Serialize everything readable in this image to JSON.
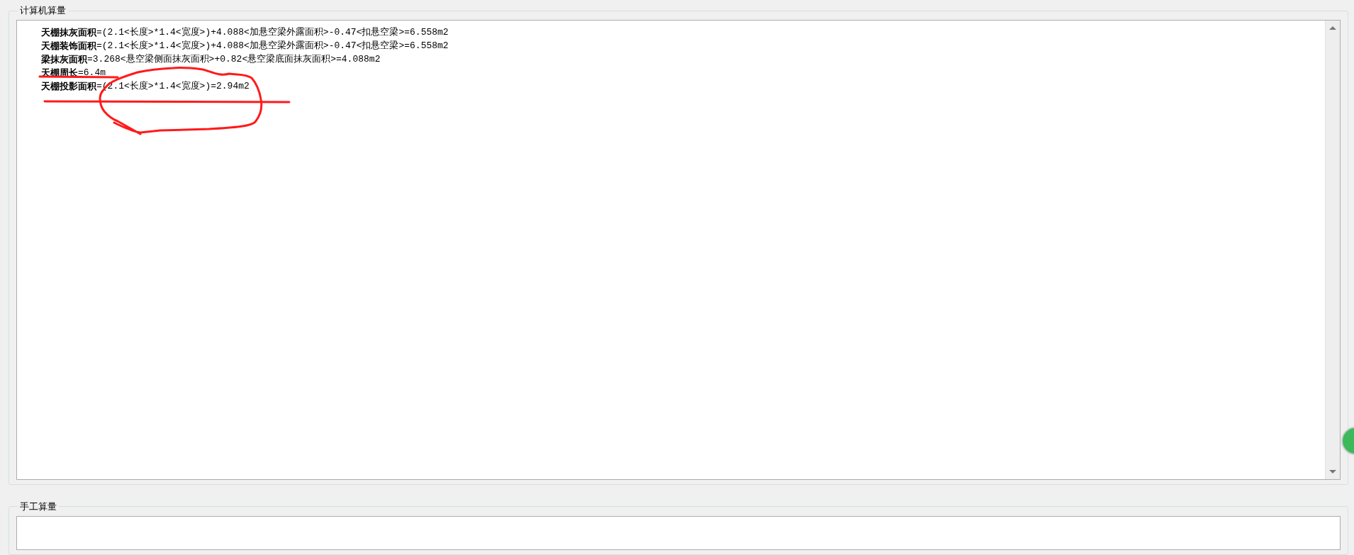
{
  "computer_group": {
    "title": "计算机算量",
    "lines": [
      {
        "label": "天棚抹灰面积",
        "formula": "=(2.1<长度>*1.4<宽度>)+4.088<加悬空梁外露面积>-0.47<扣悬空梁>=6.558m2"
      },
      {
        "label": "天棚装饰面积",
        "formula": "=(2.1<长度>*1.4<宽度>)+4.088<加悬空梁外露面积>-0.47<扣悬空梁>=6.558m2"
      },
      {
        "label": "梁抹灰面积",
        "formula": "=3.268<悬空梁侧面抹灰面积>+0.82<悬空梁底面抹灰面积>=4.088m2"
      },
      {
        "label": "天棚周长",
        "formula": "=6.4m"
      },
      {
        "label": "天棚投影面积",
        "formula": "=(2.1<长度>*1.4<宽度>)=2.94m2"
      }
    ]
  },
  "manual_group": {
    "title": "手工算量"
  }
}
